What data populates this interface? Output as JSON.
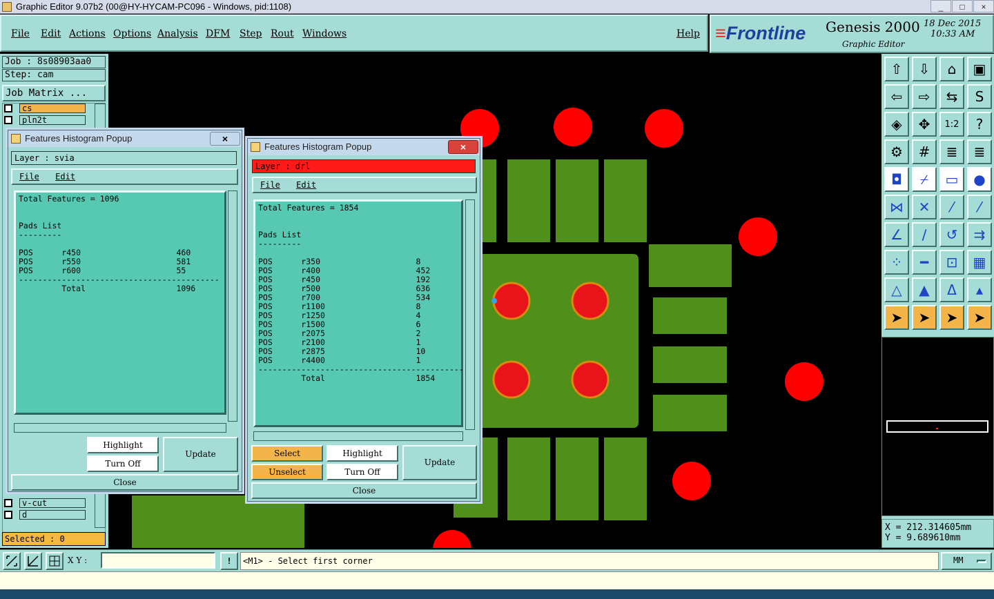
{
  "window": {
    "title": "Graphic Editor 9.07b2 (00@HY-HYCAM-PC096 - Windows, pid:1108)"
  },
  "menu": [
    "File",
    "Edit",
    "Actions",
    "Options",
    "Analysis",
    "DFM",
    "Step",
    "Rout",
    "Windows"
  ],
  "help": "Help",
  "logo": {
    "brand": "Frontline",
    "product": "Genesis 2000",
    "subtitle": "Graphic Editor",
    "date": "18 Dec 2015",
    "time": "10:33 AM"
  },
  "left": {
    "job": "Job : 8s08903aa0",
    "step": "Step: cam",
    "matrix": "Job Matrix ...",
    "layers_top": [
      "cs",
      "pln2t"
    ],
    "layers_bottom": [
      "v-cut",
      "d"
    ],
    "selected": "Selected : 0"
  },
  "popup1": {
    "title": "Features Histogram Popup",
    "close_x": "×",
    "layer": "Layer :  svia",
    "menu": [
      "File",
      "Edit"
    ],
    "text": "Total Features = 1096\n\n\nPads List\n---------\n\nPOS      r450                    460\nPOS      r550                    581\nPOS      r600                    55\n------------------------------------------\n         Total                   1096",
    "buttons": {
      "highlight": "Highlight",
      "turnoff": "Turn Off",
      "update": "Update",
      "close": "Close"
    }
  },
  "popup2": {
    "title": "Features Histogram Popup",
    "close_x": "×",
    "layer": "Layer :  drl",
    "menu": [
      "File",
      "Edit"
    ],
    "text": "Total Features = 1854\n\n\nPads List\n---------\n\nPOS      r350                    8\nPOS      r400                    452\nPOS      r450                    192\nPOS      r500                    636\nPOS      r700                    534\nPOS      r1100                   8\nPOS      r1250                   4\nPOS      r1500                   6\nPOS      r2075                   2\nPOS      r2100                   1\nPOS      r2875                   10\nPOS      r4400                   1\n--------------------------------------------\n         Total                   1854",
    "buttons": {
      "select": "Select",
      "unselect": "Unselect",
      "highlight": "Highlight",
      "turnoff": "Turn Off",
      "update": "Update",
      "close": "Close"
    }
  },
  "coords": {
    "x": "X = 212.314605mm",
    "y": "Y = 9.689610mm"
  },
  "bottom": {
    "xy_label": "X Y :",
    "xy_value": "",
    "exclamation": "!",
    "prompt": "<M1> - Select first corner",
    "units": "MM"
  },
  "toolbar_icons": [
    "up-arrow-icon",
    "down-arrow-icon",
    "home-icon",
    "window-icon",
    "left-arrow-icon",
    "right-arrow-icon",
    "flip-icon",
    "s-icon",
    "fit-icon",
    "zoom-icon",
    "1-2-icon",
    "help-icon",
    "tools-icon",
    "grid-icon",
    "layers-icon",
    "layers-alt-icon",
    "snap-icon",
    "slope-icon",
    "ruler-icon",
    "dot-icon",
    "nodes-icon",
    "cross-icon",
    "line-icon",
    "line-alt-icon",
    "angle-icon",
    "draw-icon",
    "undo-icon",
    "ff-icon",
    "dots-icon",
    "minus-icon",
    "measure-icon",
    "select-icon",
    "triangle-icon",
    "triangle2-icon",
    "triangle3-icon",
    "triangle4-icon",
    "pointer-icon",
    "pointer2-icon",
    "pointer3-icon",
    "pointer4-icon"
  ],
  "toolbar_extra": {
    "onetwo": "1:2",
    "question": "?"
  }
}
